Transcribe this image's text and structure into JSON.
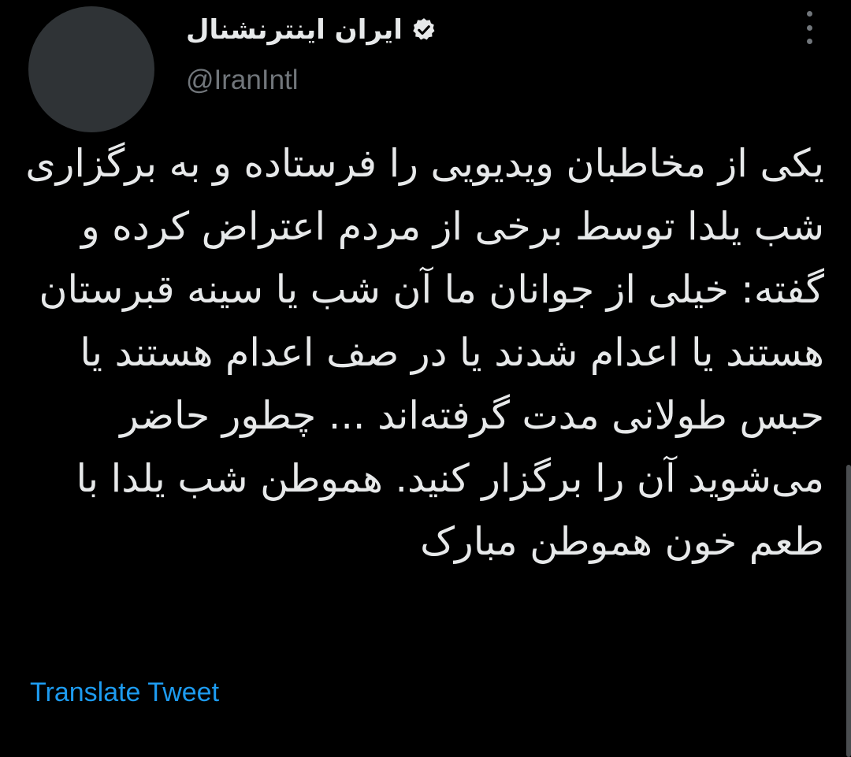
{
  "author": {
    "display_name": "ایران اینترنشنال",
    "handle": "@IranIntl",
    "verified": true
  },
  "icons": {
    "verified": "verified-badge-icon",
    "more": "more-options-icon"
  },
  "tweet": {
    "text": "یکی از مخاطبان ویدیویی را فرستاده و به برگزاری شب یلدا توسط برخی از مردم اعتراض کرده و گفته: خیلی از جوانان ما آن شب یا سینه قبرستان هستند یا اعدام شدند یا در صف اعدام هستند یا حبس طولانی مدت گرفته‌اند ... چطور حاضر می‌شوید آن را برگزار کنید. هموطن شب یلدا با طعم خون هموطن مبارک",
    "translate_label": "Translate Tweet"
  },
  "colors": {
    "background": "#000000",
    "text": "#e7e9ea",
    "secondary": "#71767b",
    "link": "#1d9bf0"
  }
}
